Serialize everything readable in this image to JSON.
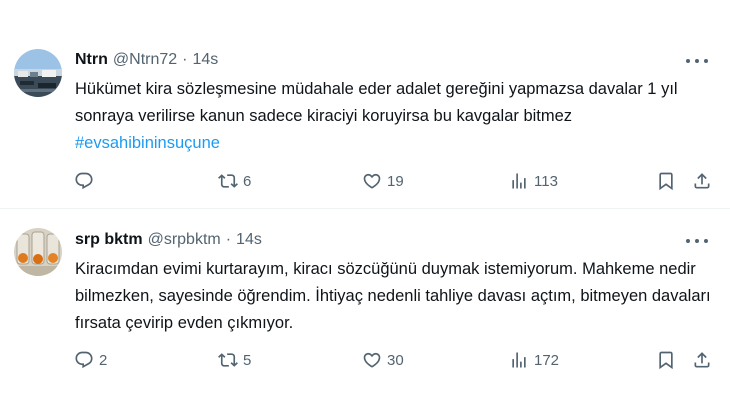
{
  "tweets": [
    {
      "name": "Ntrn",
      "handle": "@Ntrn72",
      "separator": "·",
      "time": "14s",
      "avatar_icon": "harbor-photo-avatar",
      "text_before": "Hükümet kira sözleşmesine müdahale eder adalet gereğini yapmazsa davalar 1 yıl sonraya verilirse kanun sadece kiraciyi koruyirsa bu kavgalar bitmez ",
      "hashtag": "#evsahibininsuçune",
      "replies": "",
      "retweets": "6",
      "likes": "19",
      "views": "113"
    },
    {
      "name": "srp bktm",
      "handle": "@srpbktm",
      "separator": "·",
      "time": "14s",
      "avatar_icon": "jars-photo-avatar",
      "text_before": "Kiracımdan evimi kurtarayım, kiracı sözcüğünü duymak istemiyorum. Mahkeme nedir bilmezken, sayesinde öğrendim. İhtiyaç nedenli tahliye davası açtım, bitmeyen davaları fırsata çevirip evden çıkmıyor.",
      "hashtag": "",
      "replies": "2",
      "retweets": "5",
      "likes": "30",
      "views": "172"
    }
  ],
  "colors": {
    "text": "#0f1419",
    "secondary": "#536471",
    "link": "#1d9bf0",
    "divider": "#eff3f4"
  },
  "icons": [
    "reply-icon",
    "retweet-icon",
    "like-icon",
    "views-icon",
    "bookmark-icon",
    "share-icon",
    "more-icon"
  ]
}
